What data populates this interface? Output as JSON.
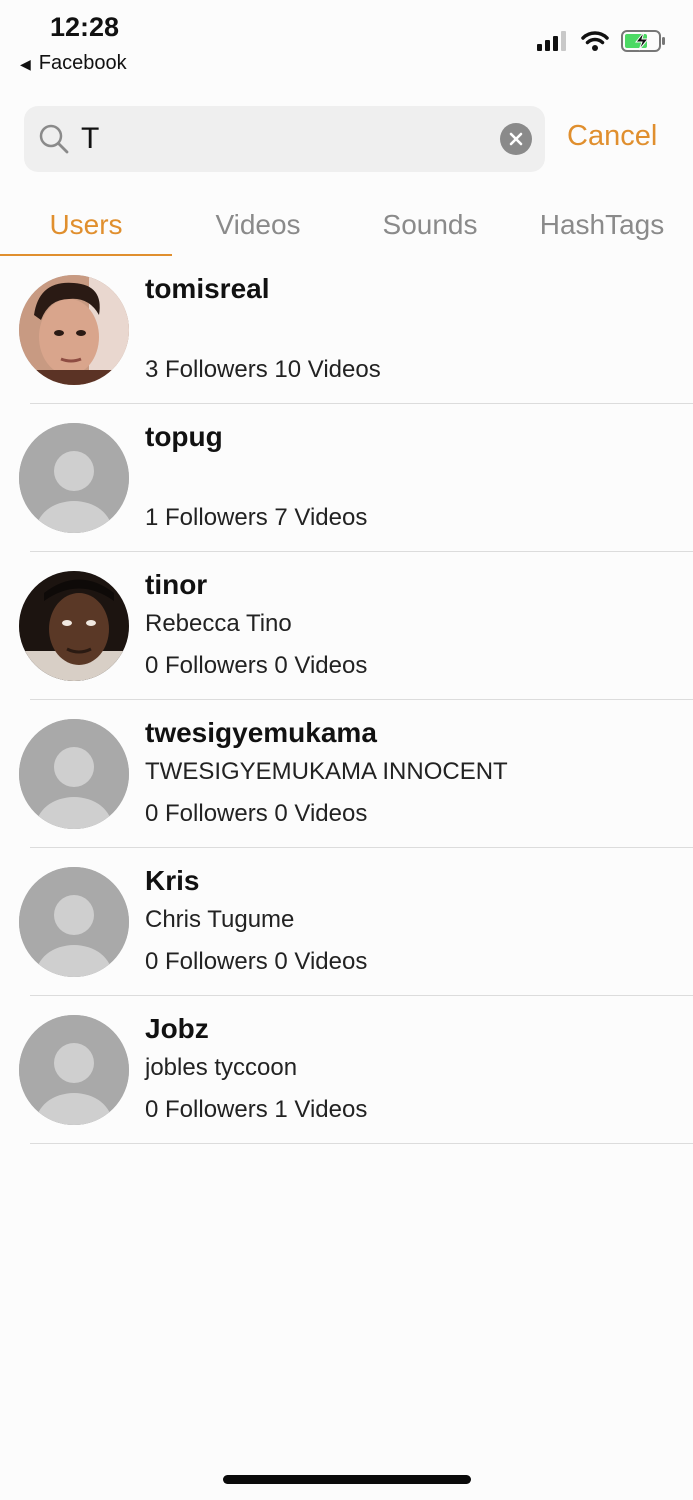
{
  "status_bar": {
    "time": "12:28",
    "back_app": "Facebook",
    "icons": [
      "signal-icon",
      "wifi-icon",
      "battery-charging-icon"
    ]
  },
  "search": {
    "value": "T",
    "placeholder": "",
    "cancel_label": "Cancel"
  },
  "tabs": [
    {
      "label": "Users",
      "active": true
    },
    {
      "label": "Videos",
      "active": false
    },
    {
      "label": "Sounds",
      "active": false
    },
    {
      "label": "HashTags",
      "active": false
    }
  ],
  "users": [
    {
      "username": "tomisreal",
      "fullname": "",
      "stats": "3 Followers 10 Videos",
      "avatar": "photo-man"
    },
    {
      "username": "topug",
      "fullname": "",
      "stats": "1 Followers 7 Videos",
      "avatar": "placeholder"
    },
    {
      "username": "tinor",
      "fullname": "Rebecca Tino",
      "stats": "0 Followers 0 Videos",
      "avatar": "photo-woman"
    },
    {
      "username": "twesigyemukama",
      "fullname": "TWESIGYEMUKAMA INNOCENT",
      "stats": "0 Followers 0 Videos",
      "avatar": "placeholder"
    },
    {
      "username": "Kris",
      "fullname": "Chris Tugume",
      "stats": "0 Followers 0 Videos",
      "avatar": "placeholder"
    },
    {
      "username": "Jobz",
      "fullname": "jobles tyccoon",
      "stats": "0 Followers 1 Videos",
      "avatar": "placeholder"
    }
  ],
  "colors": {
    "accent": "#e08f2e",
    "inactive_tab": "#8a8a8a",
    "search_bg": "#efefef",
    "avatar_placeholder": "#a9a9a9"
  }
}
